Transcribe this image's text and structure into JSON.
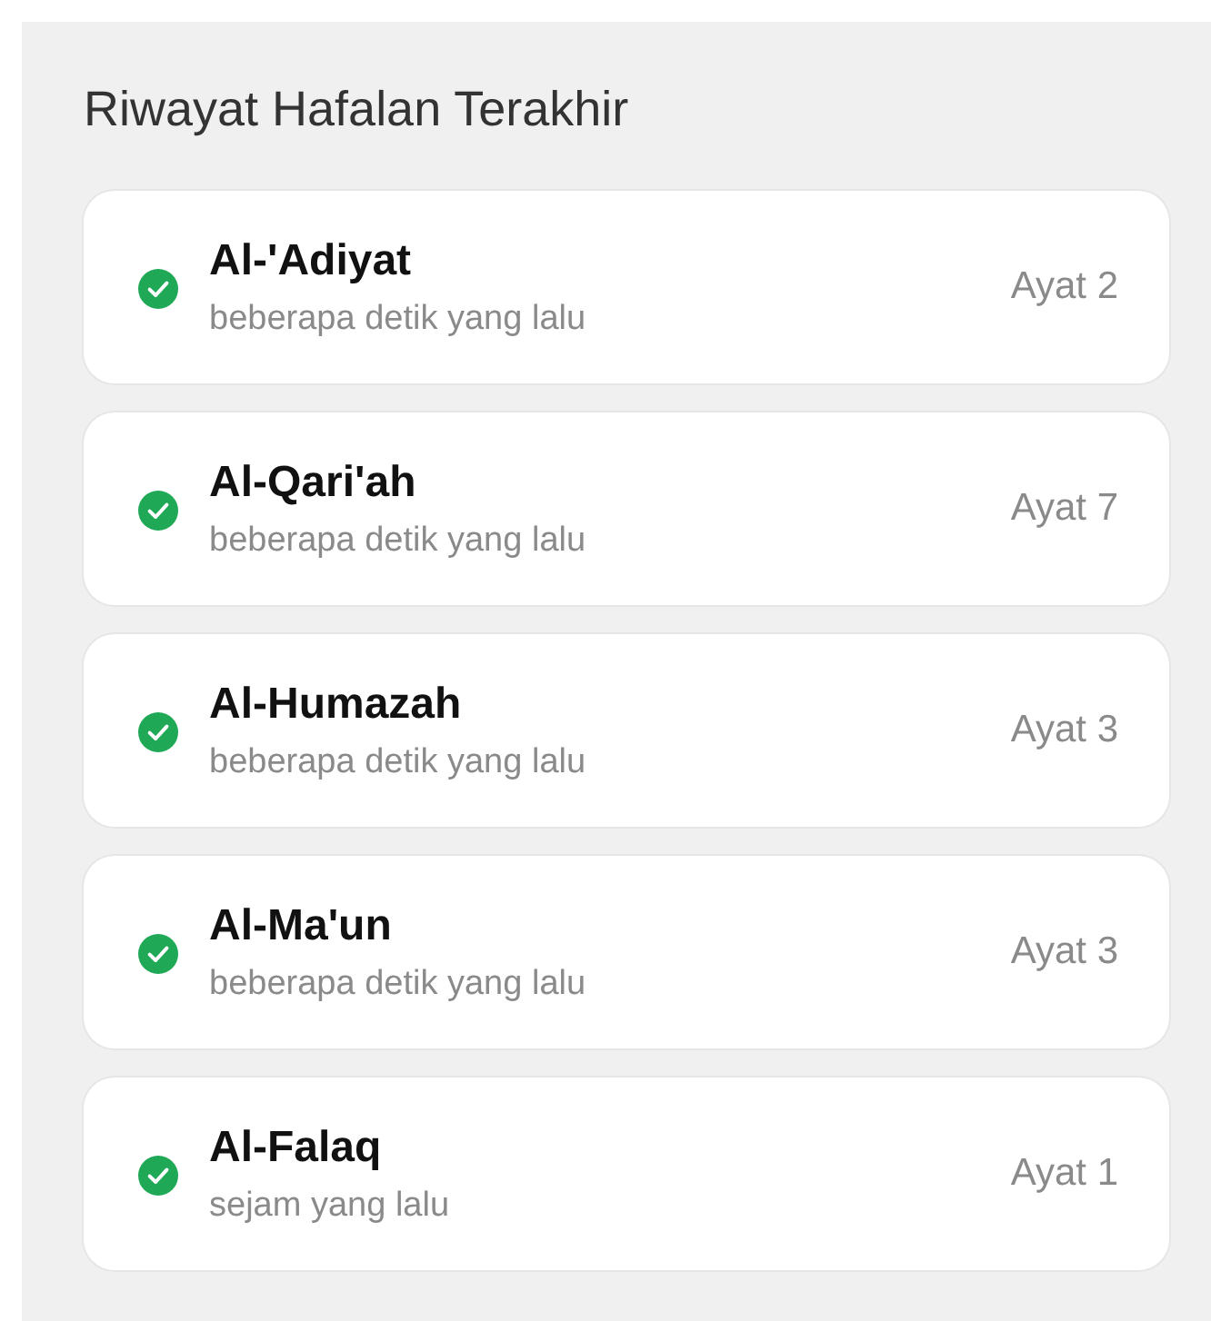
{
  "title": "Riwayat Hafalan Terakhir",
  "items": [
    {
      "surah": "Al-'Adiyat",
      "time": "beberapa detik yang lalu",
      "ayat": "Ayat 2",
      "done": true
    },
    {
      "surah": "Al-Qari'ah",
      "time": "beberapa detik yang lalu",
      "ayat": "Ayat 7",
      "done": true
    },
    {
      "surah": "Al-Humazah",
      "time": "beberapa detik yang lalu",
      "ayat": "Ayat 3",
      "done": true
    },
    {
      "surah": "Al-Ma'un",
      "time": "beberapa detik yang lalu",
      "ayat": "Ayat 3",
      "done": true
    },
    {
      "surah": "Al-Falaq",
      "time": "sejam yang lalu",
      "ayat": "Ayat 1",
      "done": true
    }
  ]
}
